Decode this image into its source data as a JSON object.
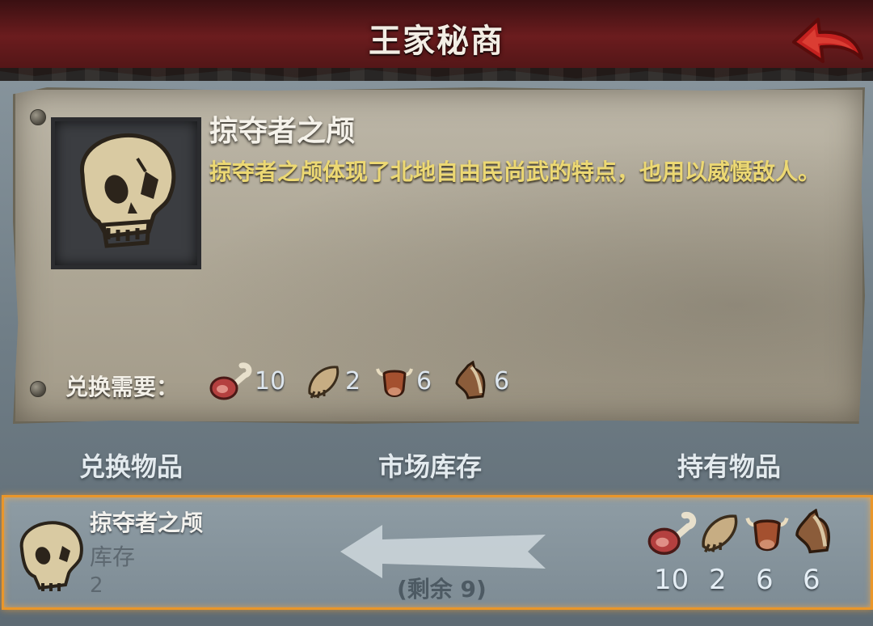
{
  "header": {
    "title": "王家秘商"
  },
  "item": {
    "name": "掠夺者之颅",
    "description": "掠夺者之颅体现了北地自由民尚武的特点，也用以威慑敌人。"
  },
  "requirements": {
    "label": "兑换需要：",
    "items": [
      {
        "icon": "meat-icon",
        "amount": "10"
      },
      {
        "icon": "fur-icon",
        "amount": "2"
      },
      {
        "icon": "ox-head-icon",
        "amount": "6"
      },
      {
        "icon": "horse-head-icon",
        "amount": "6"
      }
    ]
  },
  "columns": {
    "exchange": "兑换物品",
    "market": "市场库存",
    "owned": "持有物品"
  },
  "row": {
    "name": "掠夺者之颅",
    "stock_label": "库存",
    "stock_value": "2",
    "remaining": "(剩余 9)",
    "costs": [
      "10",
      "2",
      "6",
      "6"
    ]
  },
  "colors": {
    "accent": "#e9962a",
    "header": "#6b1c1e",
    "desc_text": "#ecd873"
  }
}
